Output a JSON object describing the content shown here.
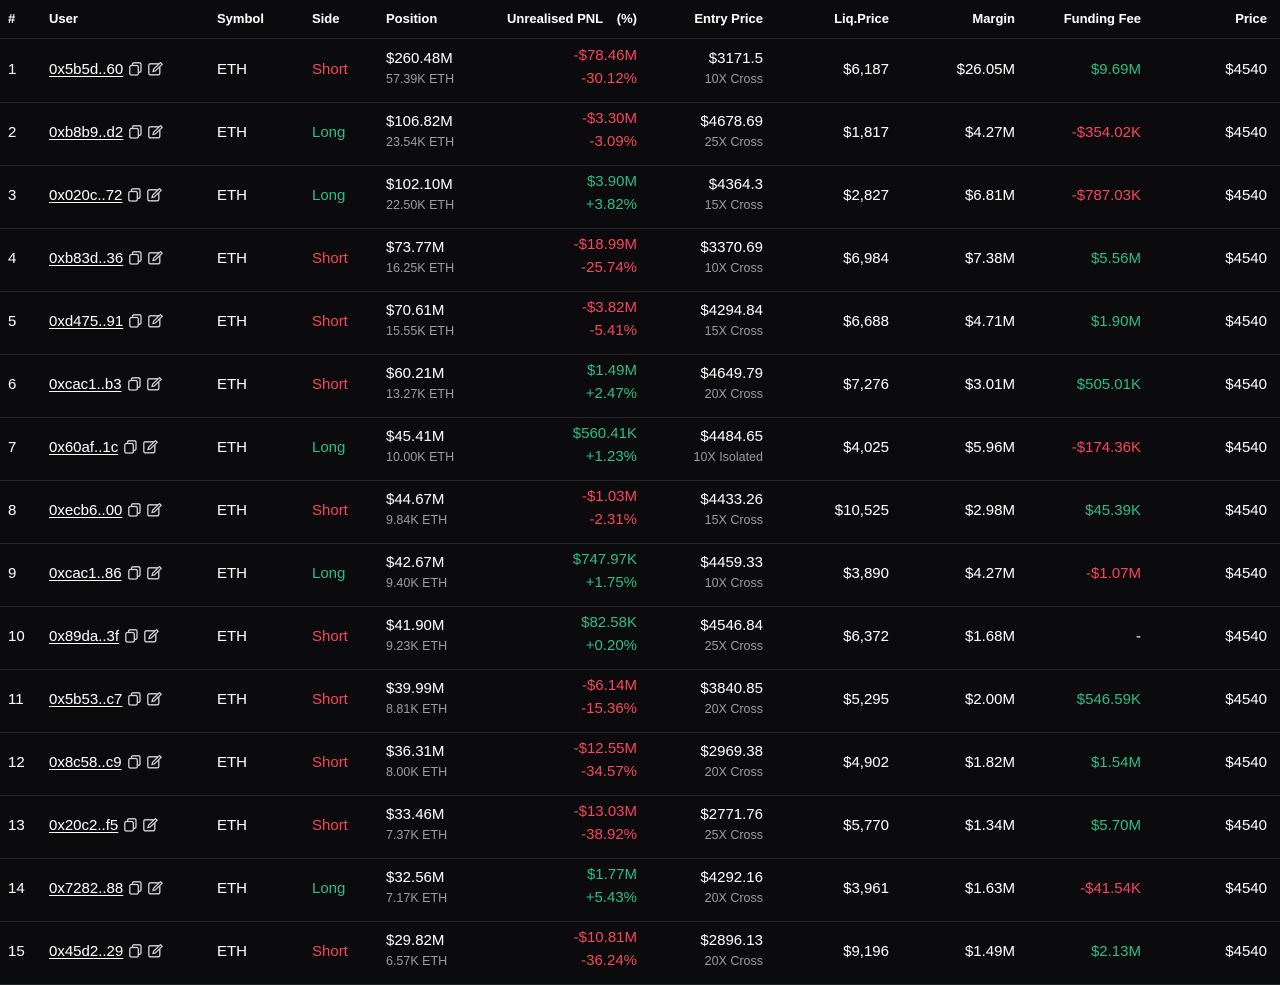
{
  "colors": {
    "positive": "#2ebd85",
    "negative": "#f6465d",
    "background": "#0b0b0e"
  },
  "headers": {
    "num": "#",
    "user": "User",
    "symbol": "Symbol",
    "side": "Side",
    "position": "Position",
    "pnl": "Unrealised PNL",
    "pnl_pct": "(%)",
    "entry": "Entry Price",
    "liq": "Liq.Price",
    "margin": "Margin",
    "funding": "Funding Fee",
    "price": "Price"
  },
  "icons": {
    "copy": "copy-icon",
    "edit": "edit-icon"
  },
  "rows": [
    {
      "num": "1",
      "user": "0x5b5d..60",
      "symbol": "ETH",
      "side": "Short",
      "side_dir": "red",
      "position": "$260.48M",
      "position_qty": "57.39K ETH",
      "pnl": "-$78.46M",
      "pnl_pct": "-30.12%",
      "pnl_dir": "red",
      "entry": "$3171.5",
      "leverage": "10X Cross",
      "liq": "$6,187",
      "margin": "$26.05M",
      "funding": "$9.69M",
      "funding_dir": "green",
      "price": "$4540"
    },
    {
      "num": "2",
      "user": "0xb8b9..d2",
      "symbol": "ETH",
      "side": "Long",
      "side_dir": "green",
      "position": "$106.82M",
      "position_qty": "23.54K ETH",
      "pnl": "-$3.30M",
      "pnl_pct": "-3.09%",
      "pnl_dir": "red",
      "entry": "$4678.69",
      "leverage": "25X Cross",
      "liq": "$1,817",
      "margin": "$4.27M",
      "funding": "-$354.02K",
      "funding_dir": "red",
      "price": "$4540"
    },
    {
      "num": "3",
      "user": "0x020c..72",
      "symbol": "ETH",
      "side": "Long",
      "side_dir": "green",
      "position": "$102.10M",
      "position_qty": "22.50K ETH",
      "pnl": "$3.90M",
      "pnl_pct": "+3.82%",
      "pnl_dir": "green",
      "entry": "$4364.3",
      "leverage": "15X Cross",
      "liq": "$2,827",
      "margin": "$6.81M",
      "funding": "-$787.03K",
      "funding_dir": "red",
      "price": "$4540"
    },
    {
      "num": "4",
      "user": "0xb83d..36",
      "symbol": "ETH",
      "side": "Short",
      "side_dir": "red",
      "position": "$73.77M",
      "position_qty": "16.25K ETH",
      "pnl": "-$18.99M",
      "pnl_pct": "-25.74%",
      "pnl_dir": "red",
      "entry": "$3370.69",
      "leverage": "10X Cross",
      "liq": "$6,984",
      "margin": "$7.38M",
      "funding": "$5.56M",
      "funding_dir": "green",
      "price": "$4540"
    },
    {
      "num": "5",
      "user": "0xd475..91",
      "symbol": "ETH",
      "side": "Short",
      "side_dir": "red",
      "position": "$70.61M",
      "position_qty": "15.55K ETH",
      "pnl": "-$3.82M",
      "pnl_pct": "-5.41%",
      "pnl_dir": "red",
      "entry": "$4294.84",
      "leverage": "15X Cross",
      "liq": "$6,688",
      "margin": "$4.71M",
      "funding": "$1.90M",
      "funding_dir": "green",
      "price": "$4540"
    },
    {
      "num": "6",
      "user": "0xcac1..b3",
      "symbol": "ETH",
      "side": "Short",
      "side_dir": "red",
      "position": "$60.21M",
      "position_qty": "13.27K ETH",
      "pnl": "$1.49M",
      "pnl_pct": "+2.47%",
      "pnl_dir": "green",
      "entry": "$4649.79",
      "leverage": "20X Cross",
      "liq": "$7,276",
      "margin": "$3.01M",
      "funding": "$505.01K",
      "funding_dir": "green",
      "price": "$4540"
    },
    {
      "num": "7",
      "user": "0x60af..1c",
      "symbol": "ETH",
      "side": "Long",
      "side_dir": "green",
      "position": "$45.41M",
      "position_qty": "10.00K ETH",
      "pnl": "$560.41K",
      "pnl_pct": "+1.23%",
      "pnl_dir": "green",
      "entry": "$4484.65",
      "leverage": "10X Isolated",
      "liq": "$4,025",
      "margin": "$5.96M",
      "funding": "-$174.36K",
      "funding_dir": "red",
      "price": "$4540"
    },
    {
      "num": "8",
      "user": "0xecb6..00",
      "symbol": "ETH",
      "side": "Short",
      "side_dir": "red",
      "position": "$44.67M",
      "position_qty": "9.84K ETH",
      "pnl": "-$1.03M",
      "pnl_pct": "-2.31%",
      "pnl_dir": "red",
      "entry": "$4433.26",
      "leverage": "15X Cross",
      "liq": "$10,525",
      "margin": "$2.98M",
      "funding": "$45.39K",
      "funding_dir": "green",
      "price": "$4540"
    },
    {
      "num": "9",
      "user": "0xcac1..86",
      "symbol": "ETH",
      "side": "Long",
      "side_dir": "green",
      "position": "$42.67M",
      "position_qty": "9.40K ETH",
      "pnl": "$747.97K",
      "pnl_pct": "+1.75%",
      "pnl_dir": "green",
      "entry": "$4459.33",
      "leverage": "10X Cross",
      "liq": "$3,890",
      "margin": "$4.27M",
      "funding": "-$1.07M",
      "funding_dir": "red",
      "price": "$4540"
    },
    {
      "num": "10",
      "user": "0x89da..3f",
      "symbol": "ETH",
      "side": "Short",
      "side_dir": "red",
      "position": "$41.90M",
      "position_qty": "9.23K ETH",
      "pnl": "$82.58K",
      "pnl_pct": "+0.20%",
      "pnl_dir": "green",
      "entry": "$4546.84",
      "leverage": "25X Cross",
      "liq": "$6,372",
      "margin": "$1.68M",
      "funding": "-",
      "funding_dir": "neutral",
      "price": "$4540"
    },
    {
      "num": "11",
      "user": "0x5b53..c7",
      "symbol": "ETH",
      "side": "Short",
      "side_dir": "red",
      "position": "$39.99M",
      "position_qty": "8.81K ETH",
      "pnl": "-$6.14M",
      "pnl_pct": "-15.36%",
      "pnl_dir": "red",
      "entry": "$3840.85",
      "leverage": "20X Cross",
      "liq": "$5,295",
      "margin": "$2.00M",
      "funding": "$546.59K",
      "funding_dir": "green",
      "price": "$4540"
    },
    {
      "num": "12",
      "user": "0x8c58..c9",
      "symbol": "ETH",
      "side": "Short",
      "side_dir": "red",
      "position": "$36.31M",
      "position_qty": "8.00K ETH",
      "pnl": "-$12.55M",
      "pnl_pct": "-34.57%",
      "pnl_dir": "red",
      "entry": "$2969.38",
      "leverage": "20X Cross",
      "liq": "$4,902",
      "margin": "$1.82M",
      "funding": "$1.54M",
      "funding_dir": "green",
      "price": "$4540"
    },
    {
      "num": "13",
      "user": "0x20c2..f5",
      "symbol": "ETH",
      "side": "Short",
      "side_dir": "red",
      "position": "$33.46M",
      "position_qty": "7.37K ETH",
      "pnl": "-$13.03M",
      "pnl_pct": "-38.92%",
      "pnl_dir": "red",
      "entry": "$2771.76",
      "leverage": "25X Cross",
      "liq": "$5,770",
      "margin": "$1.34M",
      "funding": "$5.70M",
      "funding_dir": "green",
      "price": "$4540"
    },
    {
      "num": "14",
      "user": "0x7282..88",
      "symbol": "ETH",
      "side": "Long",
      "side_dir": "green",
      "position": "$32.56M",
      "position_qty": "7.17K ETH",
      "pnl": "$1.77M",
      "pnl_pct": "+5.43%",
      "pnl_dir": "green",
      "entry": "$4292.16",
      "leverage": "20X Cross",
      "liq": "$3,961",
      "margin": "$1.63M",
      "funding": "-$41.54K",
      "funding_dir": "red",
      "price": "$4540"
    },
    {
      "num": "15",
      "user": "0x45d2..29",
      "symbol": "ETH",
      "side": "Short",
      "side_dir": "red",
      "position": "$29.82M",
      "position_qty": "6.57K ETH",
      "pnl": "-$10.81M",
      "pnl_pct": "-36.24%",
      "pnl_dir": "red",
      "entry": "$2896.13",
      "leverage": "20X Cross",
      "liq": "$9,196",
      "margin": "$1.49M",
      "funding": "$2.13M",
      "funding_dir": "green",
      "price": "$4540"
    }
  ]
}
